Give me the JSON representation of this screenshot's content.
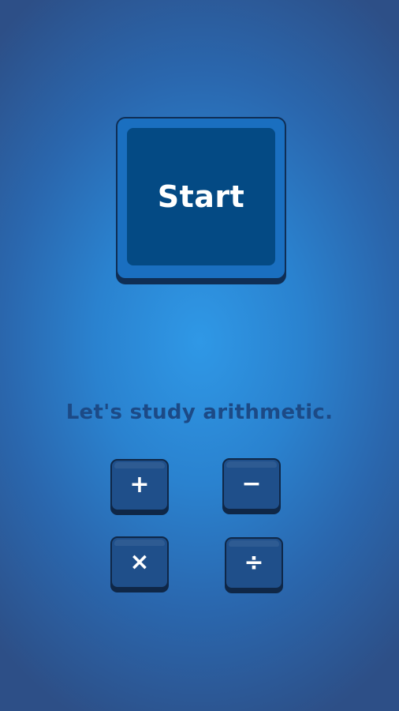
{
  "start_button": {
    "label": "Start"
  },
  "tagline": "Let's study arithmetic.",
  "operations": [
    {
      "name": "addition",
      "symbol": "+",
      "icon": "plus-icon"
    },
    {
      "name": "subtraction",
      "symbol": "−",
      "icon": "minus-icon"
    },
    {
      "name": "multiplication",
      "symbol": "×",
      "icon": "times-icon"
    },
    {
      "name": "division",
      "symbol": "÷",
      "icon": "divide-icon"
    }
  ],
  "colors": {
    "background_center": "#2f98e6",
    "background_edge": "#2d4f87",
    "start_button_face": "#044a84",
    "start_button_rim": "#1a6fc0",
    "operation_button": "#1f4f8a",
    "tagline_text": "#1c4a86"
  }
}
